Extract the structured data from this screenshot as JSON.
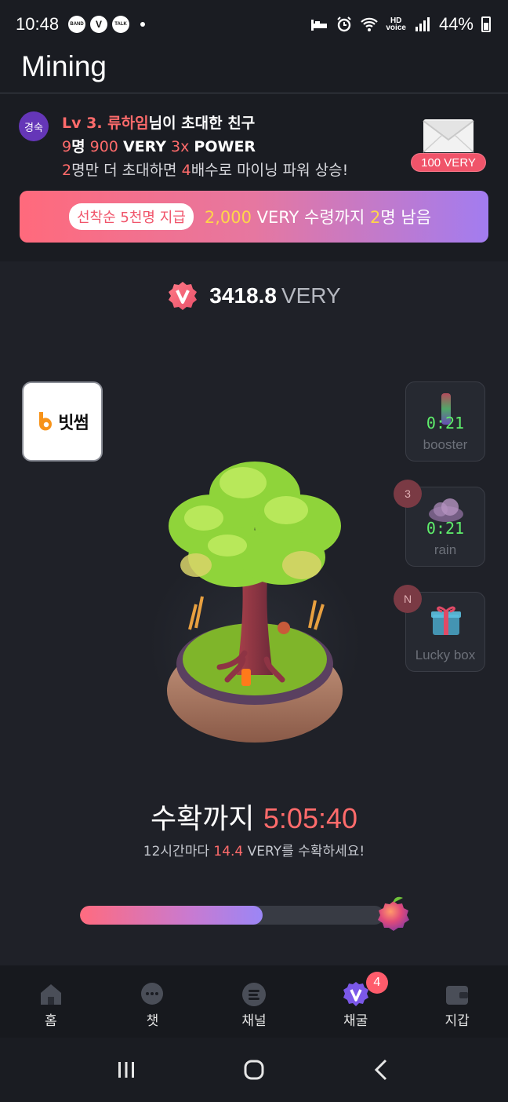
{
  "status_bar": {
    "time": "10:48",
    "notifications": [
      "BAND",
      "V",
      "TALK"
    ],
    "network": "HD voice",
    "battery": "44%"
  },
  "header": {
    "title": "Mining"
  },
  "invite": {
    "badge": "경숙",
    "line1_level": "Lv 3. 류하임",
    "line1_rest": "님이 초대한 친구",
    "line2_count": "9",
    "line2_count_unit": "명",
    "line2_amount": "900",
    "line2_amount_unit": "VERY",
    "line2_mult": "3x",
    "line2_mult_unit": "POWER",
    "line3_num1": "2",
    "line3_text1": "명만 더 초대하면",
    "line3_num2": "4",
    "line3_text2": "배수로 마이닝 파워 상승!",
    "reward": "100 VERY"
  },
  "promo": {
    "tag": "선착순 5천명 지급",
    "amount": "2,000",
    "text1": "VERY 수령까지",
    "remaining": "2",
    "text2": "명 남음"
  },
  "balance": {
    "value": "3418.8",
    "unit": "VERY",
    "icon": "v-badge-icon"
  },
  "partner": {
    "name": "빗썸",
    "icon": "bithumb-logo"
  },
  "side_cards": {
    "booster": {
      "timer": "0:21",
      "label": "booster",
      "icon": "booster-icon"
    },
    "rain": {
      "timer": "0:21",
      "label": "rain",
      "count": "3",
      "icon": "cloud-icon"
    },
    "lucky": {
      "label": "Lucky box",
      "count": "N",
      "icon": "gift-icon"
    }
  },
  "harvest": {
    "title": "수확까지",
    "countdown": "5:05:40",
    "sub_prefix": "12시간마다",
    "sub_amount": "14.4",
    "sub_suffix": "VERY를 수확하세요!",
    "progress": 0.6
  },
  "tabs": [
    {
      "label": "홈",
      "icon": "home-icon"
    },
    {
      "label": "챗",
      "icon": "chat-icon"
    },
    {
      "label": "채널",
      "icon": "channel-icon"
    },
    {
      "label": "채굴",
      "icon": "mining-icon",
      "badge": "4"
    },
    {
      "label": "지갑",
      "icon": "wallet-icon"
    }
  ],
  "colors": {
    "accent": "#ff6b6b",
    "timer_green": "#5ff06c",
    "brand_purple": "#9b86f6",
    "gold": "#ffd54a"
  }
}
